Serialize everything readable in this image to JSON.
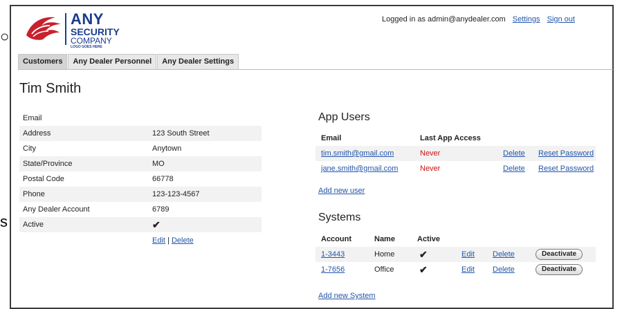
{
  "logo": {
    "line1": "ANY",
    "line2": "SECURITY",
    "line3": "COMPANY",
    "tagline": "LOGO GOES HERE",
    "icon": "eagle-logo-icon"
  },
  "topbar": {
    "logged_in_text": "Logged in as admin@anydealer.com",
    "settings_label": "Settings",
    "signout_label": "Sign out"
  },
  "tabs": [
    {
      "label": "Customers"
    },
    {
      "label": "Any Dealer Personnel"
    },
    {
      "label": "Any Dealer Settings"
    }
  ],
  "customer": {
    "name": "Tim Smith",
    "fields": [
      {
        "label": "Email",
        "value": ""
      },
      {
        "label": "Address",
        "value": "123 South Street"
      },
      {
        "label": "City",
        "value": "Anytown"
      },
      {
        "label": "State/Province",
        "value": "MO"
      },
      {
        "label": "Postal Code",
        "value": "66778"
      },
      {
        "label": "Phone",
        "value": "123-123-4567"
      },
      {
        "label": "Any Dealer Account",
        "value": "6789"
      },
      {
        "label": "Active",
        "value": "✔"
      }
    ],
    "edit_label": "Edit",
    "separator": "|",
    "delete_label": "Delete"
  },
  "app_users": {
    "title": "App Users",
    "headers": {
      "email": "Email",
      "last_access": "Last App Access"
    },
    "rows": [
      {
        "email": "tim.smith@gmail.com",
        "last_access": "Never",
        "delete": "Delete",
        "reset": "Reset Password"
      },
      {
        "email": "jane.smith@gmail.com",
        "last_access": "Never",
        "delete": "Delete",
        "reset": "Reset Password"
      }
    ],
    "add_label": "Add new user"
  },
  "systems": {
    "title": "Systems",
    "headers": {
      "account": "Account",
      "name": "Name",
      "active": "Active"
    },
    "rows": [
      {
        "account": "1-3443",
        "name": "Home",
        "active": "✔",
        "edit": "Edit",
        "delete": "Delete",
        "deactivate": "Deactivate"
      },
      {
        "account": "1-7656",
        "name": "Office",
        "active": "✔",
        "edit": "Edit",
        "delete": "Delete",
        "deactivate": "Deactivate"
      }
    ],
    "add_label": "Add new System"
  },
  "colors": {
    "link": "#2255aa",
    "never": "#cc1111",
    "brand": "#1b3b8c",
    "logo_red": "#c8202c"
  }
}
